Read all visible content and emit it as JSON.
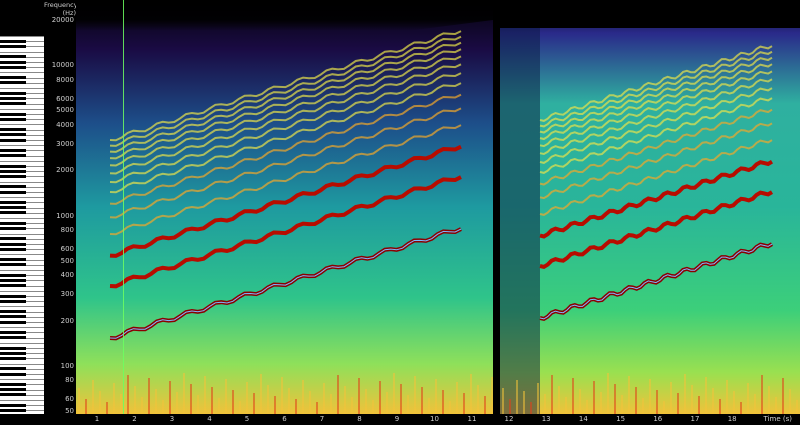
{
  "freq_axis": {
    "title": "Frequency\n(Hz)",
    "ticks": [
      {
        "label": "20000",
        "hz": 20000
      },
      {
        "label": "10000",
        "hz": 10000
      },
      {
        "label": "8000",
        "hz": 8000
      },
      {
        "label": "6000",
        "hz": 6000
      },
      {
        "label": "5000",
        "hz": 5000
      },
      {
        "label": "4000",
        "hz": 4000
      },
      {
        "label": "3000",
        "hz": 3000
      },
      {
        "label": "2000",
        "hz": 2000
      },
      {
        "label": "1000",
        "hz": 1000
      },
      {
        "label": "800",
        "hz": 800
      },
      {
        "label": "600",
        "hz": 600
      },
      {
        "label": "500",
        "hz": 500
      },
      {
        "label": "400",
        "hz": 400
      },
      {
        "label": "300",
        "hz": 300
      },
      {
        "label": "200",
        "hz": 200
      },
      {
        "label": "100",
        "hz": 100
      },
      {
        "label": "80",
        "hz": 80
      },
      {
        "label": "60",
        "hz": 60
      },
      {
        "label": "50",
        "hz": 50
      }
    ]
  },
  "time_axis": {
    "unit_label": "Time (s)",
    "ticks": [
      "1",
      "2",
      "3",
      "4",
      "5",
      "6",
      "7",
      "8",
      "9",
      "10",
      "11",
      "12",
      "13",
      "14",
      "15",
      "16",
      "17",
      "18"
    ]
  },
  "colors": {
    "background": "#000000",
    "cursor": "#6cff60",
    "low": "#2a0a5a",
    "mid": "#1fb58f",
    "high": "#ffd33d",
    "peak": "#8b0000"
  }
}
